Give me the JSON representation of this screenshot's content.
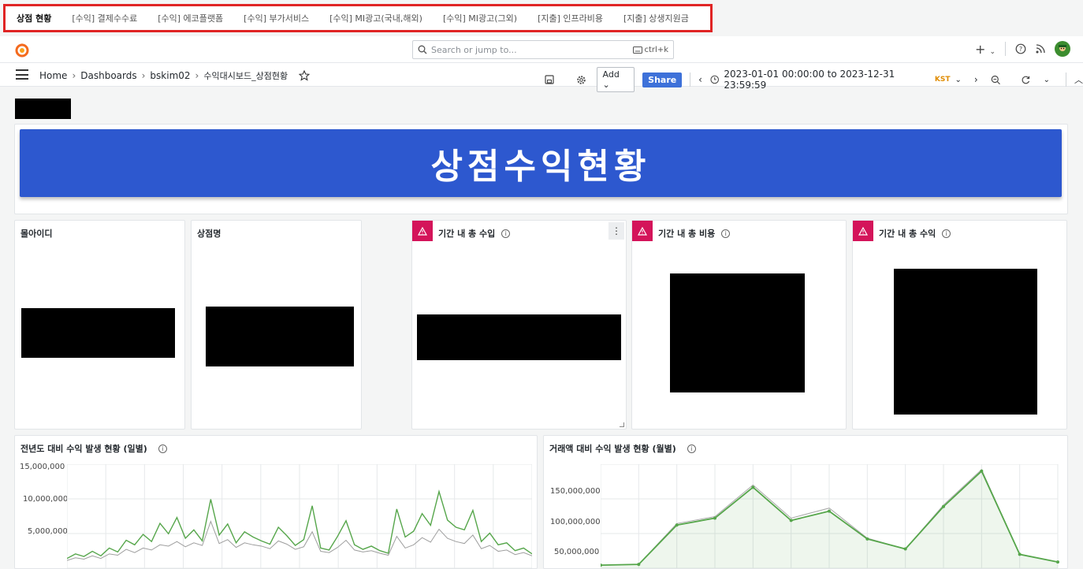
{
  "tabs": [
    {
      "label": "상점 현황",
      "active": true
    },
    {
      "label": "[수익] 결제수수료"
    },
    {
      "label": "[수익] 에코플랫폼"
    },
    {
      "label": "[수익] 부가서비스"
    },
    {
      "label": "[수익] MI광고(국내,해외)"
    },
    {
      "label": "[수익] MI광고(그외)"
    },
    {
      "label": "[지출] 인프라비용"
    },
    {
      "label": "[지출] 상생지원금"
    }
  ],
  "search": {
    "placeholder": "Search or jump to...",
    "shortcut": "ctrl+k"
  },
  "breadcrumb": {
    "home": "Home",
    "dashboards": "Dashboards",
    "folder": "bskim02",
    "dashboard": "수익대시보드_상점현황"
  },
  "toolbar": {
    "add_label": "Add",
    "share_label": "Share",
    "time_range": "2023-01-01 00:00:00 to 2023-12-31 23:59:59",
    "timezone": "KST"
  },
  "banner": {
    "title": "상점수익현황"
  },
  "panels": {
    "mall_id": "몰아이디",
    "shop_name": "상점명",
    "total_revenue": "기간 내 총 수입",
    "total_cost": "기간 내 총 비용",
    "total_profit": "기간 내 총 수익",
    "daily_chart": "전년도 대비 수익 발생 현황 (일별)",
    "monthly_chart": "거래액 대비 수익 발생 현황 (월별)"
  },
  "colors": {
    "accent": "#3d71d9",
    "banner": "#2d58cf",
    "alert": "#d4145a",
    "series_current": "#56a64b",
    "series_prev": "#9e9e9e"
  },
  "chart_data": [
    {
      "type": "line",
      "title": "전년도 대비 수익 발생 현황 (일별)",
      "yticks": [
        "15,000,000",
        "10,000,000",
        "5,000,000"
      ],
      "ylim": [
        0,
        16000000
      ],
      "series": [
        {
          "values": [
            1500000,
            2200000,
            1800000,
            2600000,
            1900000,
            3100000,
            2500000,
            4300000,
            3600000,
            5200000,
            4100000,
            6900000,
            5300000,
            7800000,
            4600000,
            5900000,
            4200000,
            10600000,
            5100000,
            6800000,
            3900000,
            5600000,
            4800000,
            4200000,
            3700000,
            6300000,
            5000000,
            3500000,
            4400000,
            9600000,
            3100000,
            2800000,
            4900000,
            7300000,
            3600000,
            2900000,
            3400000,
            2700000,
            2300000,
            9100000,
            4800000,
            5700000,
            8400000,
            6600000,
            11800000,
            7400000,
            6300000,
            5900000,
            8900000,
            4100000,
            5400000,
            3600000,
            3900000,
            2700000,
            3100000,
            2200000
          ]
        },
        {
          "values": [
            1200000,
            1600000,
            1400000,
            1900000,
            1500000,
            2200000,
            2000000,
            2900000,
            2400000,
            3100000,
            2800000,
            3600000,
            3400000,
            4100000,
            3300000,
            3900000,
            3500000,
            7200000,
            3800000,
            4400000,
            3200000,
            3900000,
            3600000,
            3400000,
            3000000,
            4200000,
            3700000,
            2900000,
            3300000,
            5600000,
            2600000,
            2400000,
            3200000,
            4300000,
            2800000,
            2500000,
            2700000,
            2300000,
            2000000,
            4900000,
            3100000,
            3600000,
            4700000,
            4000000,
            6000000,
            4600000,
            4100000,
            3800000,
            5100000,
            3000000,
            3500000,
            2600000,
            2800000,
            2100000,
            2400000,
            1900000
          ]
        }
      ]
    },
    {
      "type": "area",
      "title": "거래액 대비 수익 발생 현황 (월별)",
      "yticks": [
        "150,000,000",
        "100,000,000",
        "50,000,000"
      ],
      "ylim": [
        45000000,
        180000000
      ],
      "series": [
        {
          "values": [
            49000000,
            50000000,
            101000000,
            110000000,
            150000000,
            107000000,
            119000000,
            83000000,
            70000000,
            125000000,
            171000000,
            63000000,
            53000000
          ]
        },
        {
          "values": [
            49000000,
            50000000,
            103000000,
            112000000,
            153000000,
            110000000,
            123000000,
            84000000,
            70000000,
            127000000,
            173000000,
            63000000,
            53000000
          ]
        }
      ]
    }
  ]
}
